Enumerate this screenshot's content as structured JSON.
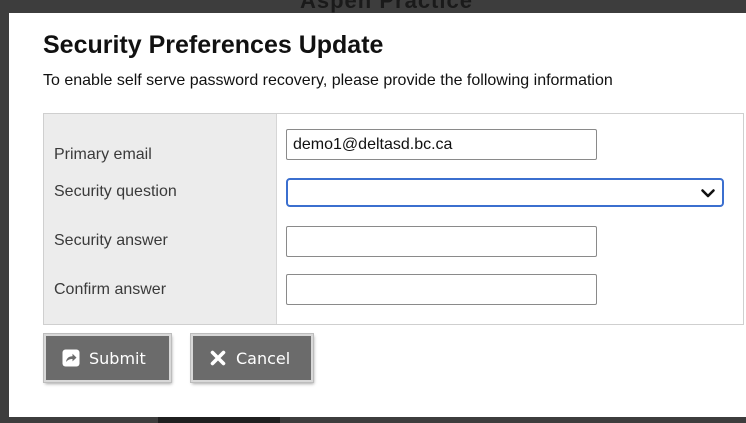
{
  "background": {
    "title_fragment": "Aspen Practice"
  },
  "dialog": {
    "title": "Security Preferences Update",
    "description": "To enable self serve password recovery, please provide the following information",
    "fields": {
      "primary_email": {
        "label": "Primary email",
        "value": "demo1@deltasd.bc.ca"
      },
      "security_question": {
        "label": "Security question",
        "selected": ""
      },
      "security_answer": {
        "label": "Security answer",
        "value": ""
      },
      "confirm_answer": {
        "label": "Confirm answer",
        "value": ""
      }
    },
    "buttons": {
      "submit_label": "Submit",
      "cancel_label": "Cancel"
    }
  },
  "icons": {
    "submit": "share-arrow-icon",
    "cancel": "x-icon",
    "select": "chevron-down-icon"
  },
  "colors": {
    "focus_border": "#3b6fcf",
    "button_bg": "#6b6b6b",
    "label_panel_bg": "#ececec"
  }
}
